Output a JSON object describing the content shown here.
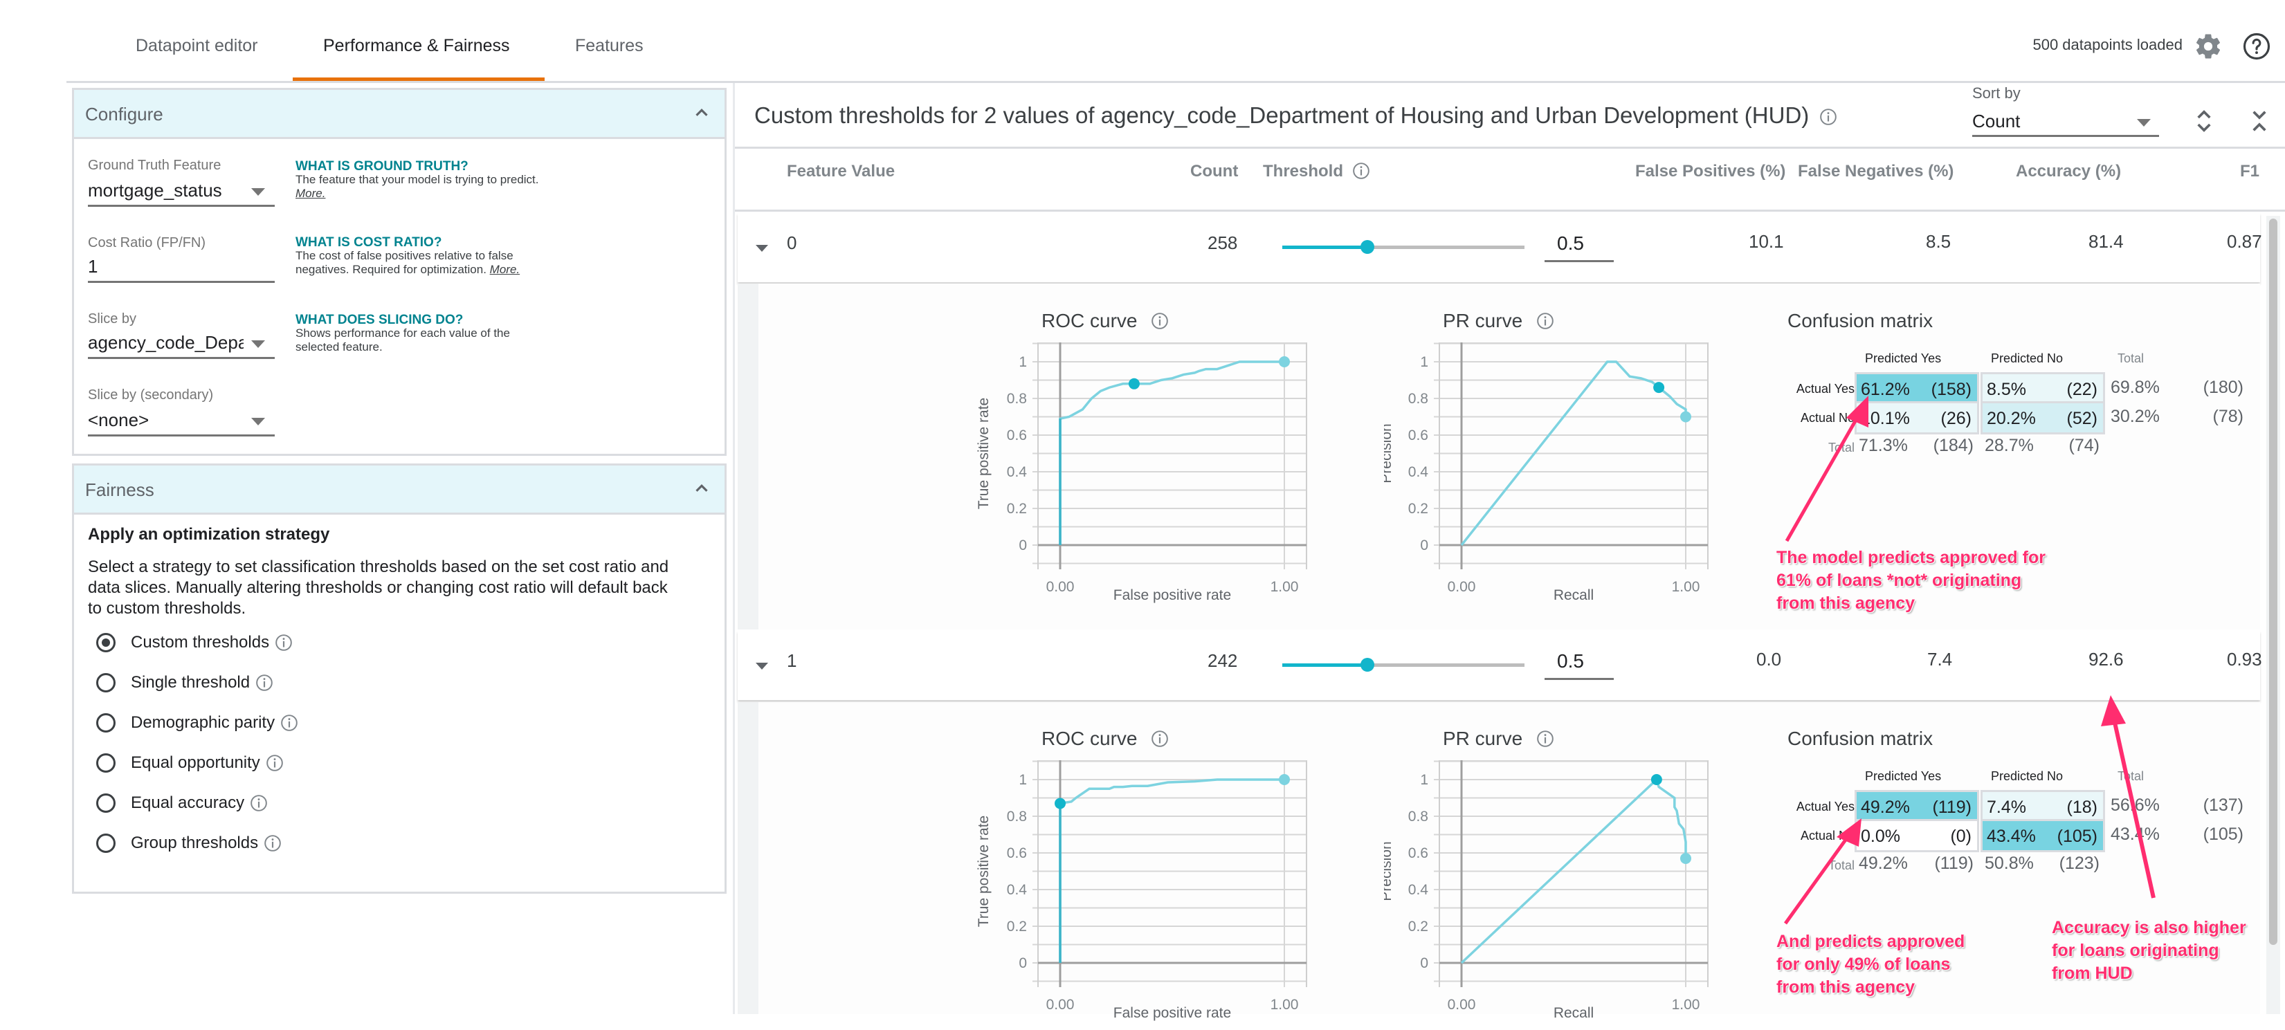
{
  "tabs": [
    {
      "label": "Datapoint editor",
      "active": false
    },
    {
      "label": "Performance & Fairness",
      "active": true
    },
    {
      "label": "Features",
      "active": false
    }
  ],
  "status": {
    "datapoints_loaded": "500 datapoints loaded",
    "settings_icon": "gear-icon",
    "help_icon": "help-circle-icon"
  },
  "colors": {
    "accent": "#12b5cb",
    "tab_underline": "#e8710a",
    "panel_header_bg": "#e4f6fa",
    "help_title": "#00838f",
    "annotation": "#ff2d6f",
    "cm_tp_strong": "#78d3e1",
    "cm_light": "#eaf7f9"
  },
  "configure": {
    "title": "Configure",
    "ground_truth": {
      "label": "Ground Truth Feature",
      "value": "mortgage_status",
      "help_title": "WHAT IS GROUND TRUTH?",
      "help_text": "The feature that your model is trying to predict.",
      "help_link": "More."
    },
    "cost_ratio": {
      "label": "Cost Ratio (FP/FN)",
      "value": "1",
      "help_title": "WHAT IS COST RATIO?",
      "help_text": "The cost of false positives relative to false negatives. Required for optimization.",
      "help_link": "More."
    },
    "slice_by": {
      "label": "Slice by",
      "value": "agency_code_Department of Housing and Urban Development (HUD)",
      "help_title": "WHAT DOES SLICING DO?",
      "help_text": "Shows performance for each value of the selected feature."
    },
    "slice_by_secondary": {
      "label": "Slice by (secondary)",
      "value": "<none>"
    }
  },
  "fairness": {
    "title": "Fairness",
    "strategy_title": "Apply an optimization strategy",
    "strategy_desc": "Select a strategy to set classification thresholds based on the set cost ratio and data slices. Manually altering thresholds or changing cost ratio will default back to custom thresholds.",
    "options": [
      {
        "label": "Custom thresholds",
        "selected": true
      },
      {
        "label": "Single threshold",
        "selected": false
      },
      {
        "label": "Demographic parity",
        "selected": false
      },
      {
        "label": "Equal opportunity",
        "selected": false
      },
      {
        "label": "Equal accuracy",
        "selected": false
      },
      {
        "label": "Group thresholds",
        "selected": false
      }
    ]
  },
  "main": {
    "title": "Custom thresholds for 2 values of agency_code_Department of Housing and Urban Development (HUD)",
    "sort_by": {
      "label": "Sort by",
      "value": "Count"
    },
    "columns": [
      "Feature Value",
      "Count",
      "Threshold",
      "False Positives (%)",
      "False Negatives (%)",
      "Accuracy (%)",
      "F1"
    ],
    "rows": [
      {
        "feature_value": "0",
        "count": "258",
        "threshold": 0.5,
        "threshold_text": "0.5",
        "false_positives": "10.1",
        "false_negatives": "8.5",
        "accuracy": "81.4",
        "f1": "0.87"
      },
      {
        "feature_value": "1",
        "count": "242",
        "threshold": 0.5,
        "threshold_text": "0.5",
        "false_positives": "0.0",
        "false_negatives": "7.4",
        "accuracy": "92.6",
        "f1": "0.93"
      }
    ]
  },
  "chart_labels": {
    "roc_title": "ROC curve",
    "pr_title": "PR curve",
    "cm_title": "Confusion matrix",
    "roc_xlabel": "False positive rate",
    "roc_ylabel": "True positive rate",
    "pr_xlabel": "Recall",
    "pr_ylabel": "Precision",
    "x_ticks": [
      "0.00",
      "1.00"
    ],
    "y_ticks": [
      "0",
      "0.2",
      "0.4",
      "0.6",
      "0.8",
      "1"
    ],
    "cm_pred_yes": "Predicted Yes",
    "cm_pred_no": "Predicted No",
    "cm_total": "Total",
    "cm_actual_yes": "Actual Yes",
    "cm_actual_no": "Actual No"
  },
  "chart_data": [
    {
      "type": "line",
      "title": "ROC curve",
      "slice": "0",
      "xlabel": "False positive rate",
      "ylabel": "True positive rate",
      "xlim": [
        0,
        1
      ],
      "ylim": [
        0,
        1
      ],
      "grid": true,
      "x": [
        0,
        0,
        0.04,
        0.07,
        0.1,
        0.14,
        0.18,
        0.22,
        0.28,
        0.33,
        0.4,
        0.45,
        0.5,
        0.55,
        0.6,
        0.62,
        0.65,
        0.7,
        0.75,
        0.8,
        1.0
      ],
      "y": [
        0,
        0.69,
        0.7,
        0.72,
        0.74,
        0.8,
        0.84,
        0.86,
        0.88,
        0.88,
        0.88,
        0.9,
        0.91,
        0.93,
        0.94,
        0.95,
        0.96,
        0.96,
        0.98,
        1.0,
        1.0
      ],
      "selected_point": [
        0.33,
        0.88
      ]
    },
    {
      "type": "line",
      "title": "PR curve",
      "slice": "0",
      "xlabel": "Recall",
      "ylabel": "Precision",
      "xlim": [
        0,
        1
      ],
      "ylim": [
        0,
        1
      ],
      "grid": true,
      "x": [
        0,
        0.65,
        0.69,
        0.72,
        0.75,
        0.8,
        0.85,
        0.88,
        0.93,
        0.96,
        1.0,
        1.0
      ],
      "y": [
        0,
        1.0,
        1.0,
        0.96,
        0.92,
        0.91,
        0.89,
        0.86,
        0.81,
        0.77,
        0.74,
        0.7
      ],
      "selected_point": [
        0.88,
        0.86
      ]
    },
    {
      "type": "table",
      "title": "Confusion matrix",
      "slice": "0",
      "cells": {
        "tp": [
          "61.2%",
          "(158)"
        ],
        "fn": [
          "8.5%",
          "(22)"
        ],
        "fp": [
          "10.1%",
          "(26)"
        ],
        "tn": [
          "20.2%",
          "(52)"
        ]
      },
      "row_totals": [
        [
          "69.8%",
          "(180)"
        ],
        [
          "30.2%",
          "(78)"
        ]
      ],
      "col_totals": [
        [
          "71.3%",
          "(184)"
        ],
        [
          "28.7%",
          "(74)"
        ]
      ]
    },
    {
      "type": "line",
      "title": "ROC curve",
      "slice": "1",
      "xlabel": "False positive rate",
      "ylabel": "True positive rate",
      "xlim": [
        0,
        1
      ],
      "ylim": [
        0,
        1
      ],
      "grid": true,
      "x": [
        0,
        0,
        0.05,
        0.07,
        0.13,
        0.22,
        0.24,
        0.28,
        0.32,
        0.39,
        0.48,
        0.6,
        0.7,
        1.0
      ],
      "y": [
        0,
        0.87,
        0.88,
        0.9,
        0.95,
        0.95,
        0.96,
        0.96,
        0.965,
        0.965,
        0.985,
        0.99,
        1.0,
        1.0
      ],
      "selected_point": [
        0,
        0.87
      ]
    },
    {
      "type": "line",
      "title": "PR curve",
      "slice": "1",
      "xlabel": "Recall",
      "ylabel": "Precision",
      "xlim": [
        0,
        1
      ],
      "ylim": [
        0,
        1
      ],
      "grid": true,
      "x": [
        0,
        0.87,
        0.88,
        0.95,
        0.95,
        0.96,
        0.97,
        0.99,
        1.0,
        1.0
      ],
      "y": [
        0,
        1.0,
        0.96,
        0.9,
        0.85,
        0.83,
        0.76,
        0.73,
        0.66,
        0.57
      ],
      "selected_point": [
        0.87,
        1.0
      ]
    },
    {
      "type": "table",
      "title": "Confusion matrix",
      "slice": "1",
      "cells": {
        "tp": [
          "49.2%",
          "(119)"
        ],
        "fn": [
          "7.4%",
          "(18)"
        ],
        "fp": [
          "0.0%",
          "(0)"
        ],
        "tn": [
          "43.4%",
          "(105)"
        ]
      },
      "row_totals": [
        [
          "56.6%",
          "(137)"
        ],
        [
          "43.4%",
          "(105)"
        ]
      ],
      "col_totals": [
        [
          "49.2%",
          "(119)"
        ],
        [
          "50.8%",
          "(123)"
        ]
      ]
    }
  ],
  "annotations": [
    "The model predicts approved for\n61% of loans *not* originating\nfrom this agency",
    "And predicts approved\nfor only 49% of loans\nfrom this agency",
    "Accuracy is also higher\nfor loans originating\nfrom HUD"
  ]
}
